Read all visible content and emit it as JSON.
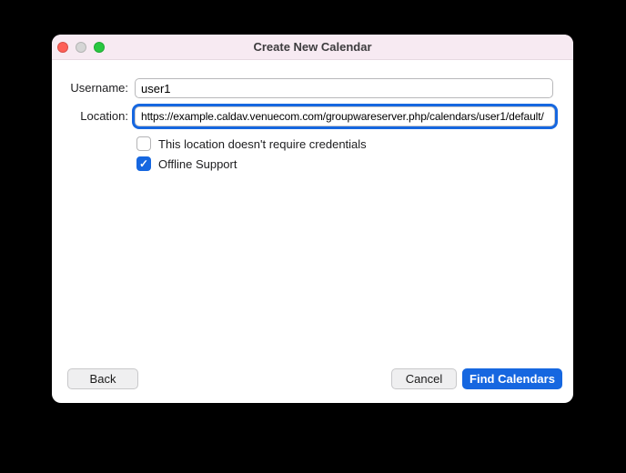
{
  "window": {
    "title": "Create New Calendar"
  },
  "titlebar": {
    "close_icon": "red-traffic-light",
    "minimize_icon": "gray-traffic-light",
    "zoom_icon": "green-traffic-light"
  },
  "form": {
    "username_label": "Username:",
    "username_value": "user1",
    "location_label": "Location:",
    "location_value": "https://example.caldav.venuecom.com/groupwareserver.php/calendars/user1/default/",
    "checkboxes": [
      {
        "label": "This location doesn't require credentials",
        "checked": false
      },
      {
        "label": "Offline Support",
        "checked": true
      }
    ]
  },
  "buttons": {
    "back": "Back",
    "cancel": "Cancel",
    "find_calendars": "Find Calendars"
  },
  "colors": {
    "accent_blue": "#1667e0",
    "titlebar_pink": "#f7eaf2",
    "traffic_red": "#fe5f57",
    "traffic_gray": "#d5d5d5",
    "traffic_green": "#28c840",
    "window_background": "#ffffff",
    "desktop_background": "#000000"
  }
}
